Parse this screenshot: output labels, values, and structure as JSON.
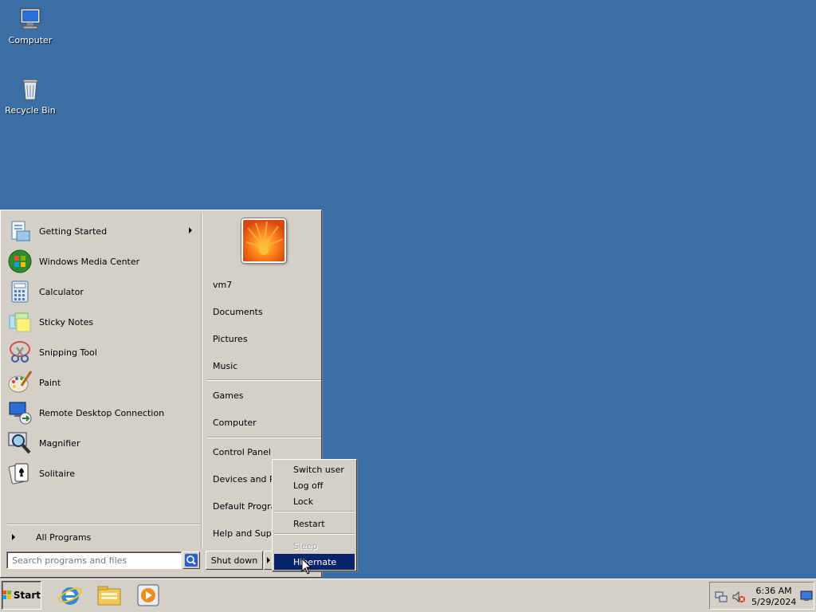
{
  "desktop": {
    "icons": [
      {
        "label": "Computer",
        "icon": "computer-icon"
      },
      {
        "label": "Recycle Bin",
        "icon": "recycle-bin-icon"
      }
    ]
  },
  "start_menu": {
    "programs": [
      {
        "label": "Getting Started",
        "icon": "getting-started-icon",
        "has_submenu": true
      },
      {
        "label": "Windows Media Center",
        "icon": "media-center-icon"
      },
      {
        "label": "Calculator",
        "icon": "calculator-icon"
      },
      {
        "label": "Sticky Notes",
        "icon": "sticky-notes-icon"
      },
      {
        "label": "Snipping Tool",
        "icon": "snipping-tool-icon"
      },
      {
        "label": "Paint",
        "icon": "paint-icon"
      },
      {
        "label": "Remote Desktop Connection",
        "icon": "remote-desktop-icon"
      },
      {
        "label": "Magnifier",
        "icon": "magnifier-icon"
      },
      {
        "label": "Solitaire",
        "icon": "solitaire-icon"
      }
    ],
    "all_programs": "All Programs",
    "search_placeholder": "Search programs and files",
    "right_items": [
      {
        "label": "vm7"
      },
      {
        "label": "Documents"
      },
      {
        "label": "Pictures"
      },
      {
        "label": "Music"
      },
      {
        "label": "Games"
      },
      {
        "label": "Computer"
      },
      {
        "label": "Control Panel"
      },
      {
        "label": "Devices and Pri"
      },
      {
        "label": "Default Program"
      },
      {
        "label": "Help and Suppo"
      }
    ],
    "shutdown_label": "Shut down"
  },
  "shutdown_menu": {
    "items": [
      {
        "label": "Switch user"
      },
      {
        "label": "Log off"
      },
      {
        "label": "Lock"
      },
      {
        "label": "Restart"
      },
      {
        "label": "Sleep",
        "disabled": true
      },
      {
        "label": "Hibernate",
        "selected": true
      }
    ]
  },
  "taskbar": {
    "start_label": "Start",
    "quick_launch": [
      "internet-explorer-icon",
      "windows-explorer-icon",
      "media-player-icon"
    ],
    "tray_icons": [
      "network-icon",
      "volume-muted-icon"
    ],
    "time": "6:36 AM",
    "date": "5/29/2024"
  },
  "colors": {
    "desktop": "#3a6ea5",
    "selection": "#0a246a",
    "face": "#d4d0c8"
  }
}
